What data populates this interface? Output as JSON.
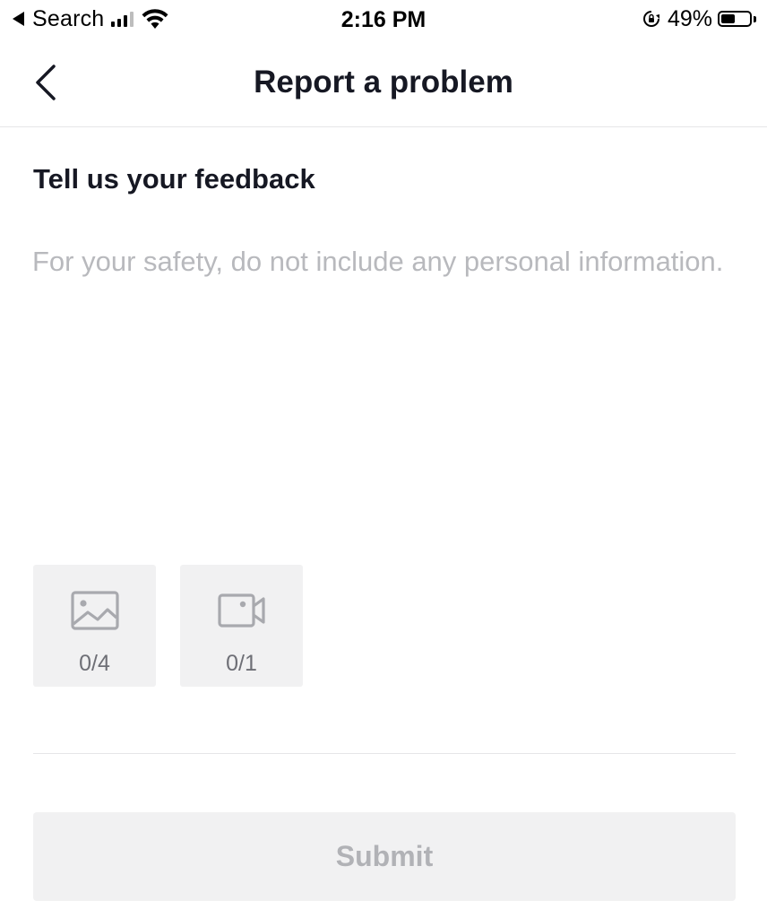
{
  "status_bar": {
    "back_app": "Search",
    "time": "2:16 PM",
    "battery_percent": "49%",
    "battery_level": 0.49,
    "signal_bars": 3
  },
  "nav": {
    "title": "Report a problem",
    "back_icon": "chevron-left-icon"
  },
  "feedback": {
    "title": "Tell us your feedback",
    "placeholder": "For your safety, do not include any personal information.",
    "value": ""
  },
  "attachments": {
    "photo": {
      "icon": "image-icon",
      "count": "0/4"
    },
    "video": {
      "icon": "video-camera-icon",
      "count": "0/1"
    }
  },
  "submit": {
    "label": "Submit",
    "enabled": false
  },
  "colors": {
    "text_primary": "#161823",
    "placeholder": "#b8b9bd",
    "tile_bg": "#f1f1f2",
    "disabled_text": "#b1b2b6"
  }
}
